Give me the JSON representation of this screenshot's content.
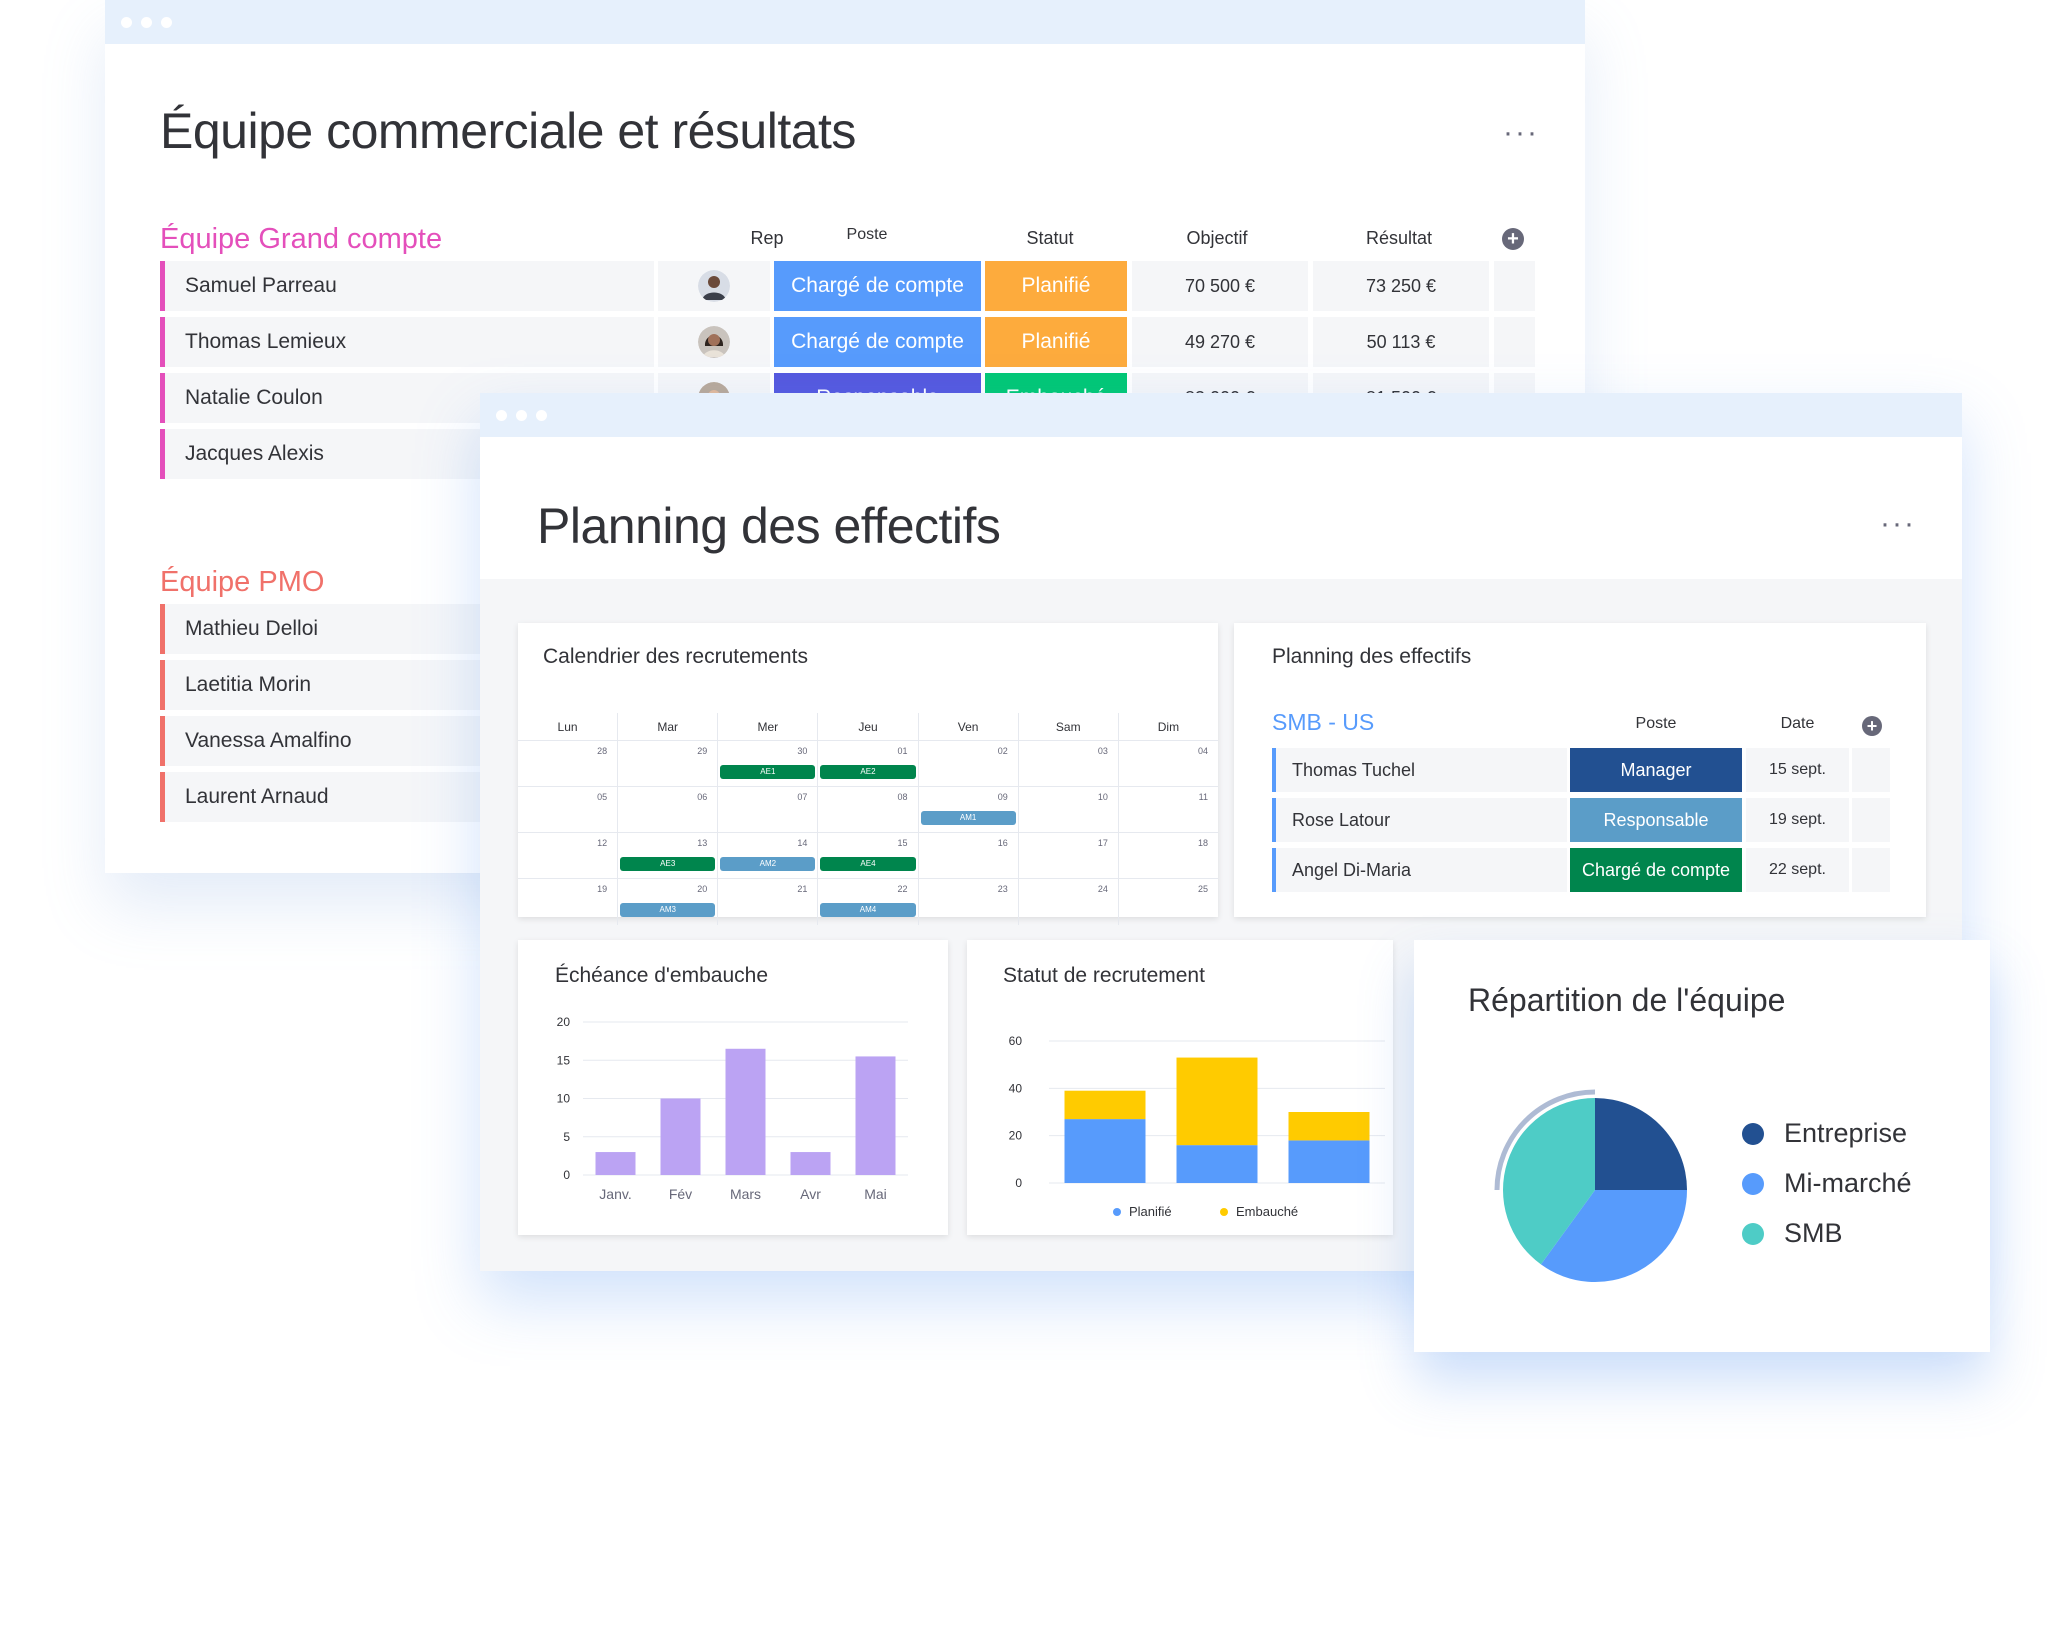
{
  "window1": {
    "title": "Équipe commerciale et résultats",
    "menu": "···",
    "columns": {
      "rep": "Rep",
      "poste": "Poste",
      "statut": "Statut",
      "objectif": "Objectif",
      "resultat": "Résultat"
    },
    "group1": {
      "title": "Équipe Grand compte",
      "color": "#e44fbb",
      "rows": [
        {
          "name": "Samuel Parreau",
          "poste": "Chargé de compte",
          "poste_color": "#579bfc",
          "statut": "Planifié",
          "statut_color": "#fdab3d",
          "objectif": "70 500 €",
          "resultat": "73 250 €"
        },
        {
          "name": "Thomas Lemieux",
          "poste": "Chargé de compte",
          "poste_color": "#579bfc",
          "statut": "Planifié",
          "statut_color": "#fdab3d",
          "objectif": "49 270 €",
          "resultat": "50 113 €"
        },
        {
          "name": "Natalie Coulon",
          "poste": "Responsable",
          "poste_color": "#5559df",
          "statut": "Embauché",
          "statut_color": "#00c875",
          "objectif": "83 000 €",
          "resultat": "81 500 €"
        },
        {
          "name": "Jacques Alexis"
        }
      ]
    },
    "group2": {
      "title": "Équipe PMO",
      "color": "#f0716a",
      "rows": [
        {
          "name": "Mathieu Delloi"
        },
        {
          "name": "Laetitia Morin"
        },
        {
          "name": "Vanessa Amalfino"
        },
        {
          "name": "Laurent Arnaud"
        }
      ]
    }
  },
  "window2": {
    "title": "Planning des effectifs",
    "menu": "···",
    "calendar": {
      "title": "Calendrier des recrutements",
      "days": [
        "Lun",
        "Mar",
        "Mer",
        "Jeu",
        "Ven",
        "Sam",
        "Dim"
      ],
      "weeks": [
        [
          {
            "date": "28"
          },
          {
            "date": "29"
          },
          {
            "date": "30",
            "event": "AE1",
            "color": "#00854d"
          },
          {
            "date": "01",
            "event": "AE2",
            "color": "#00854d"
          },
          {
            "date": "02"
          },
          {
            "date": "03"
          },
          {
            "date": "04"
          }
        ],
        [
          {
            "date": "05"
          },
          {
            "date": "06"
          },
          {
            "date": "07"
          },
          {
            "date": "08"
          },
          {
            "date": "09",
            "event": "AM1",
            "color": "#5b9dc8"
          },
          {
            "date": "10"
          },
          {
            "date": "11"
          }
        ],
        [
          {
            "date": "12"
          },
          {
            "date": "13",
            "event": "AE3",
            "color": "#00854d"
          },
          {
            "date": "14",
            "event": "AM2",
            "color": "#5b9dc8"
          },
          {
            "date": "15",
            "event": "AE4",
            "color": "#00854d"
          },
          {
            "date": "16"
          },
          {
            "date": "17"
          },
          {
            "date": "18"
          }
        ],
        [
          {
            "date": "19"
          },
          {
            "date": "20",
            "event": "AM3",
            "color": "#5b9dc8"
          },
          {
            "date": "21"
          },
          {
            "date": "22",
            "event": "AM4",
            "color": "#5b9dc8"
          },
          {
            "date": "23"
          },
          {
            "date": "24"
          },
          {
            "date": "25"
          }
        ]
      ]
    },
    "planning": {
      "title": "Planning des effectifs",
      "group": "SMB - US",
      "group_color": "#579bfc",
      "columns": {
        "poste": "Poste",
        "date": "Date"
      },
      "rows": [
        {
          "name": "Thomas Tuchel",
          "poste": "Manager",
          "poste_color": "#225091",
          "date": "15 sept."
        },
        {
          "name": "Rose Latour",
          "poste": "Responsable",
          "poste_color": "#5b9dc8",
          "date": "19 sept."
        },
        {
          "name": "Angel Di-Maria",
          "poste": "Chargé de compte",
          "poste_color": "#00854d",
          "date": "22 sept."
        }
      ]
    }
  },
  "chart_data": [
    {
      "type": "bar",
      "title": "Échéance d'embauche",
      "categories": [
        "Janv.",
        "Fév",
        "Mars",
        "Avr",
        "Mai"
      ],
      "values": [
        3,
        10,
        16.5,
        3,
        15.5
      ],
      "ylim": [
        0,
        20
      ],
      "yticks": [
        0,
        5,
        10,
        15,
        20
      ],
      "color": "#bba3f3",
      "grid": true
    },
    {
      "type": "bar",
      "stacked": true,
      "title": "Statut de recrutement",
      "categories": [
        "",
        "",
        ""
      ],
      "series": [
        {
          "name": "Planifié",
          "values": [
            27,
            16,
            18
          ],
          "color": "#579bfc"
        },
        {
          "name": "Embauché",
          "values": [
            12,
            37,
            12
          ],
          "color": "#ffcb00"
        }
      ],
      "ylim": [
        0,
        60
      ],
      "yticks": [
        0,
        20,
        40,
        60
      ],
      "legend": "bottom",
      "grid": true
    },
    {
      "type": "pie",
      "title": "Répartition de l'équipe",
      "slices": [
        {
          "name": "Entreprise",
          "value": 25,
          "color": "#225091"
        },
        {
          "name": "Mi-marché",
          "value": 35,
          "color": "#579bfc"
        },
        {
          "name": "SMB",
          "value": 40,
          "color": "#4eccc6"
        }
      ],
      "legend": "right"
    }
  ]
}
